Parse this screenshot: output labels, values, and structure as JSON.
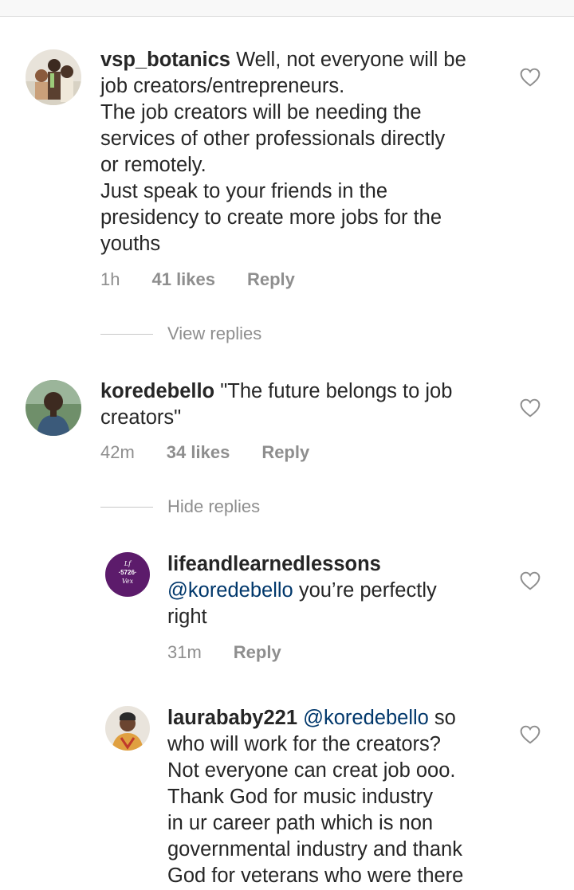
{
  "comments": [
    {
      "username": "vsp_botanics",
      "text_lines": [
        "Well, not everyone will be",
        "job creators/entrepreneurs.",
        "The job creators will be needing the",
        "services of other professionals directly",
        "or remotely.",
        "Just speak to your friends in the",
        "presidency to create more jobs for the",
        "youths"
      ],
      "time": "1h",
      "likes": "41 likes",
      "reply": "Reply",
      "thread_toggle": "View replies"
    },
    {
      "username": "koredebello",
      "text_lines": [
        "\"The future belongs to job",
        "creators\""
      ],
      "time": "42m",
      "likes": "34 likes",
      "reply": "Reply",
      "thread_toggle": "Hide replies"
    }
  ],
  "replies": [
    {
      "username": "lifeandlearnedlessons",
      "avatar_text": [
        "Lf",
        "·5726·",
        "Vex"
      ],
      "mention": "@koredebello",
      "text_lines": [
        " you’re perfectly",
        "right"
      ],
      "time": "31m",
      "reply": "Reply"
    },
    {
      "username": "laurababy221",
      "mention": "@koredebello",
      "text_lines": [
        " so",
        "who will work for the  creators?",
        "Not everyone can creat job ooo.",
        "Thank God for music industry",
        "in ur career path which is non",
        "governmental industry and thank",
        "God for veterans who were there"
      ]
    }
  ],
  "colors": {
    "text": "#262626",
    "meta": "#8e8e8e",
    "mention": "#00376b",
    "purple_avatar": "#5c1b6b"
  }
}
